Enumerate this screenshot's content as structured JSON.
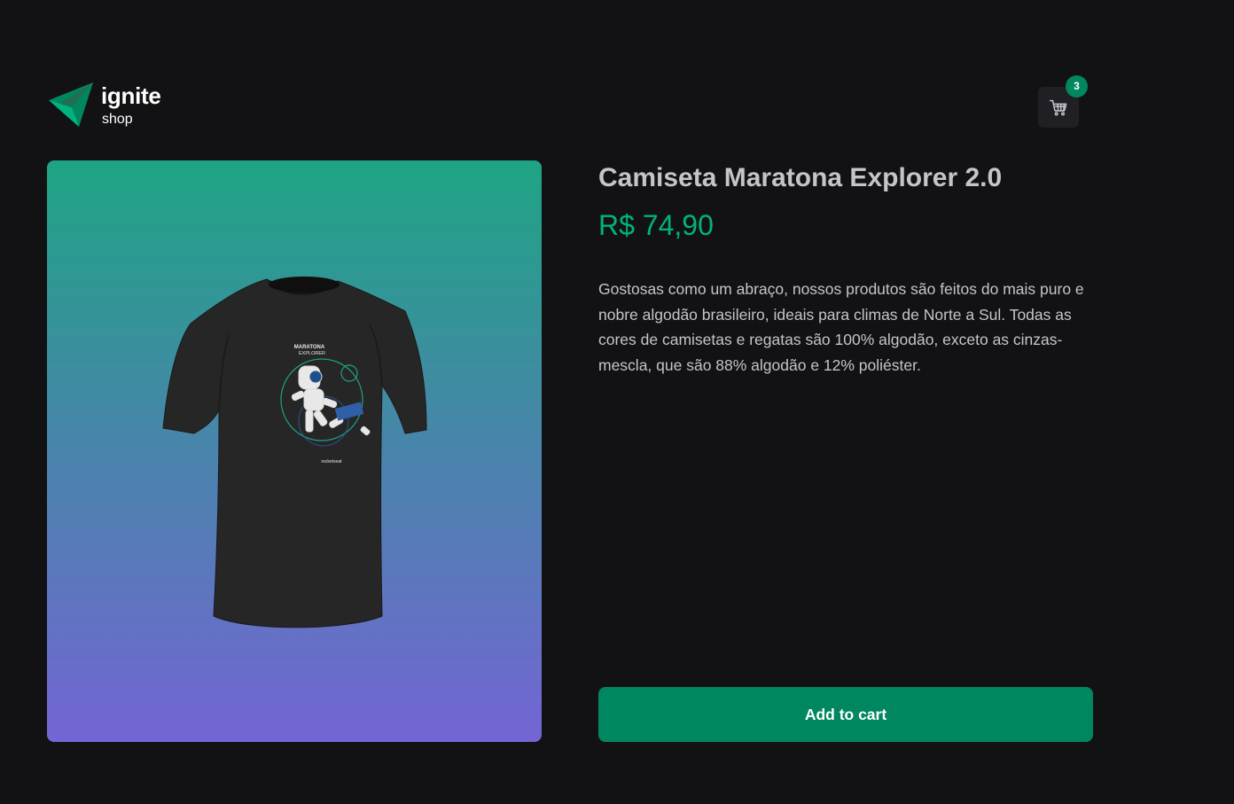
{
  "header": {
    "logo": {
      "wordmark": "ignite",
      "subtitle": "shop"
    },
    "cart": {
      "icon": "shopping-cart-icon",
      "count": "3"
    }
  },
  "product": {
    "image": {
      "alt": "Camiseta Maratona Explorer 2.0",
      "print_title": "MARATONA",
      "print_subtitle": "EXPLORER",
      "print_brand": "rocketseat"
    },
    "name": "Camiseta Maratona Explorer 2.0",
    "price": "R$ 74,90",
    "description": "Gostosas como um abraço, nossos produtos são feitos do mais puro e nobre algodão brasileiro, ideais para climas de Norte a Sul. Todas as cores de camisetas e regatas são 100% algodão, exceto as cinzas-mescla, que são 88% algodão e 12% poliéster.",
    "add_to_cart_label": "Add to cart"
  },
  "colors": {
    "background": "#121214",
    "accent": "#00875f",
    "price": "#00b37e",
    "text": "#c4c4cc",
    "image_gradient_start": "#1ea483",
    "image_gradient_end": "#7465d4"
  }
}
